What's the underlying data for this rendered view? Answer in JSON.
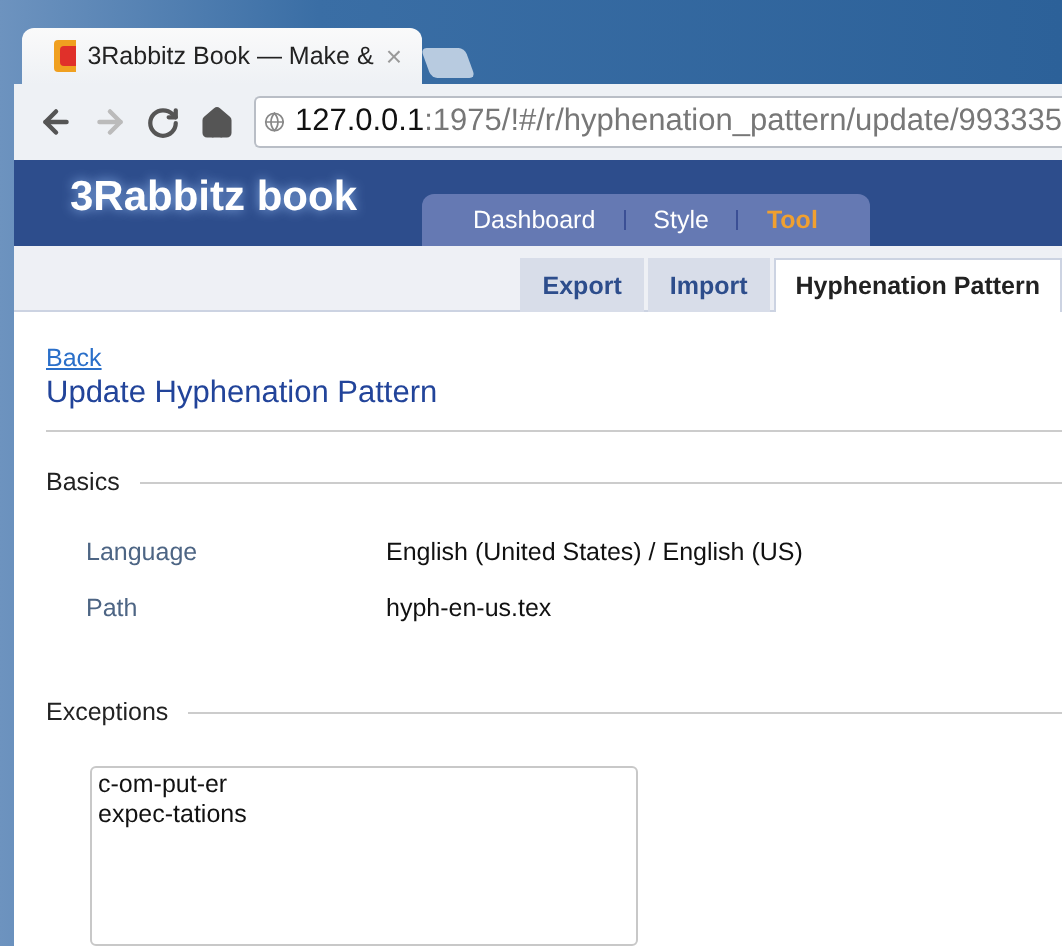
{
  "browser": {
    "tab": {
      "title": "3Rabbitz Book — Make &",
      "close": "×"
    },
    "address": {
      "host": "127.0.0.1",
      "path": ":1975/!#/r/hyphenation_pattern/update/993335"
    },
    "forward_disabled": true
  },
  "header": {
    "logo": "3Rabbitz book",
    "nav": [
      {
        "label": "Dashboard",
        "selected": false
      },
      {
        "label": "Style",
        "selected": false
      },
      {
        "label": "Tool",
        "selected": true
      }
    ]
  },
  "subnav": [
    {
      "label": "Export",
      "selected": false
    },
    {
      "label": "Import",
      "selected": false
    },
    {
      "label": "Hyphenation Pattern",
      "selected": true
    }
  ],
  "back_link": "Back",
  "title": "Update Hyphenation Pattern",
  "basics": {
    "heading": "Basics",
    "fields": [
      {
        "label": "Language",
        "value": "English (United States) / English (US)"
      },
      {
        "label": "Path",
        "value": "hyph-en-us.tex"
      }
    ]
  },
  "exceptions": {
    "heading": "Exceptions",
    "value": "c-om-put-er\nexpec-tations"
  }
}
